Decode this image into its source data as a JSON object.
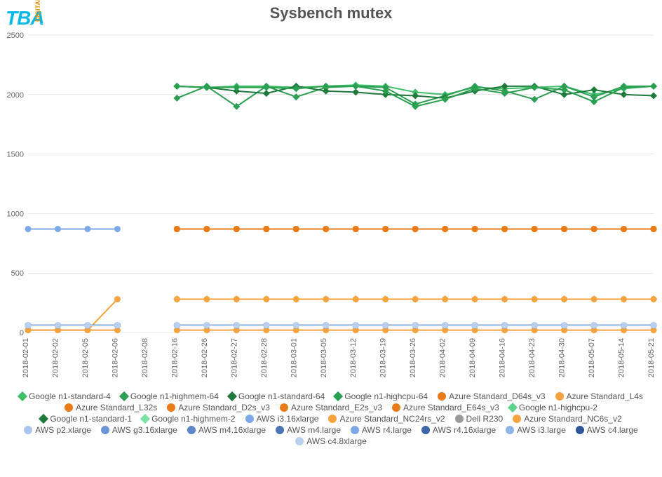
{
  "logo": {
    "main": "TBA",
    "sub": "DIGITAL"
  },
  "chart_data": {
    "type": "line",
    "title": "Sysbench mutex",
    "xlabel": "",
    "ylabel": "",
    "ylim": [
      0,
      2500
    ],
    "yticks": [
      0,
      500,
      1000,
      1500,
      2000,
      2500
    ],
    "categories": [
      "2018-02-01",
      "2018-02-02",
      "2018-02-05",
      "2018-02-06",
      "2018-02-08",
      "2018-02-16",
      "2018-02-26",
      "2018-02-27",
      "2018-02-28",
      "2018-03-01",
      "2018-03-05",
      "2018-03-12",
      "2018-03-19",
      "2018-03-26",
      "2018-04-02",
      "2018-04-09",
      "2018-04-16",
      "2018-04-23",
      "2018-04-30",
      "2018-05-07",
      "2018-05-14",
      "2018-05-21"
    ],
    "series": [
      {
        "name": "Google n1-standard-4",
        "color": "#3fbf6a",
        "shape": "diamond",
        "values": [
          null,
          null,
          null,
          null,
          null,
          2070,
          2060,
          2070,
          2070,
          2060,
          2070,
          2080,
          2070,
          2020,
          2000,
          2060,
          2050,
          2060,
          2070,
          2000,
          2050,
          2070
        ]
      },
      {
        "name": "Google n1-highmem-64",
        "color": "#2e9e55",
        "shape": "diamond",
        "values": [
          null,
          null,
          null,
          null,
          null,
          1970,
          2070,
          1900,
          2070,
          1980,
          2060,
          2070,
          2060,
          1920,
          1990,
          2070,
          2030,
          1960,
          2070,
          1980,
          2070,
          2070
        ]
      },
      {
        "name": "Google n1-standard-64",
        "color": "#1f7a3c",
        "shape": "diamond",
        "values": [
          null,
          null,
          null,
          null,
          null,
          2070,
          2060,
          2030,
          2010,
          2070,
          2030,
          2020,
          2000,
          1990,
          1970,
          2030,
          2070,
          2070,
          2000,
          2040,
          2000,
          1990
        ]
      },
      {
        "name": "Google n1-highcpu-64",
        "color": "#28a04f",
        "shape": "diamond",
        "values": [
          null,
          null,
          null,
          null,
          null,
          2070,
          2060,
          2060,
          2060,
          2050,
          2070,
          2070,
          2030,
          1900,
          1960,
          2050,
          2010,
          2060,
          2040,
          1940,
          2060,
          2070
        ]
      },
      {
        "name": "Azure Standard_D64s_v3",
        "color": "#e87c1a",
        "shape": "circle",
        "values": [
          null,
          null,
          null,
          null,
          null,
          870,
          870,
          870,
          870,
          870,
          870,
          870,
          870,
          870,
          870,
          870,
          870,
          870,
          870,
          870,
          870,
          870
        ]
      },
      {
        "name": "Azure Standard_L4s",
        "color": "#f5a33e",
        "shape": "circle",
        "values": [
          null,
          null,
          null,
          null,
          null,
          870,
          870,
          870,
          870,
          870,
          870,
          870,
          870,
          870,
          870,
          870,
          870,
          870,
          870,
          870,
          870,
          870
        ]
      },
      {
        "name": "Azure Standard_L32s",
        "color": "#e87c1a",
        "shape": "circle",
        "values": [
          null,
          null,
          null,
          null,
          null,
          870,
          870,
          870,
          870,
          870,
          870,
          870,
          870,
          870,
          870,
          870,
          870,
          870,
          870,
          870,
          870,
          870
        ]
      },
      {
        "name": "Azure Standard_D2s_v3",
        "color": "#e87c1a",
        "shape": "circle",
        "values": [
          null,
          null,
          null,
          null,
          null,
          870,
          870,
          870,
          870,
          870,
          870,
          870,
          870,
          870,
          870,
          870,
          870,
          870,
          870,
          870,
          870,
          870
        ]
      },
      {
        "name": "Azure Standard_E2s_v3",
        "color": "#e87c1a",
        "shape": "circle",
        "values": [
          null,
          null,
          null,
          null,
          null,
          870,
          870,
          870,
          870,
          870,
          870,
          870,
          870,
          870,
          870,
          870,
          870,
          870,
          870,
          870,
          870,
          870
        ]
      },
      {
        "name": "Azure Standard_E64s_v3",
        "color": "#e87c1a",
        "shape": "circle",
        "values": [
          null,
          null,
          null,
          null,
          null,
          870,
          870,
          870,
          870,
          870,
          870,
          870,
          870,
          870,
          870,
          870,
          870,
          870,
          870,
          870,
          870,
          870
        ]
      },
      {
        "name": "Google n1-highcpu-2",
        "color": "#5ed38a",
        "shape": "diamond",
        "values": [
          null,
          null,
          null,
          null,
          null,
          280,
          280,
          280,
          280,
          280,
          280,
          280,
          280,
          280,
          280,
          280,
          280,
          280,
          280,
          280,
          280,
          280
        ]
      },
      {
        "name": "Google n1-standard-1",
        "color": "#1f7a3c",
        "shape": "diamond",
        "values": [
          null,
          null,
          null,
          null,
          null,
          280,
          280,
          280,
          280,
          280,
          280,
          280,
          280,
          280,
          280,
          280,
          280,
          280,
          280,
          280,
          280,
          280
        ]
      },
      {
        "name": "Google n1-highmem-2",
        "color": "#7de0a5",
        "shape": "diamond",
        "values": [
          null,
          null,
          null,
          null,
          null,
          280,
          280,
          280,
          280,
          280,
          280,
          280,
          280,
          280,
          280,
          280,
          280,
          280,
          280,
          280,
          280,
          280
        ]
      },
      {
        "name": "AWS i3.16xlarge",
        "color": "#7da8e6",
        "shape": "circle",
        "values": [
          870,
          870,
          870,
          870,
          null,
          null,
          null,
          null,
          null,
          null,
          null,
          null,
          null,
          null,
          null,
          null,
          null,
          null,
          null,
          null,
          null,
          null
        ]
      },
      {
        "name": "Azure Standard_NC24rs_v2",
        "color": "#f5a33e",
        "shape": "circle",
        "values": [
          20,
          20,
          20,
          280,
          null,
          280,
          280,
          280,
          280,
          280,
          280,
          280,
          280,
          280,
          280,
          280,
          280,
          280,
          280,
          280,
          280,
          280
        ]
      },
      {
        "name": "Dell R230",
        "color": "#9a9a9a",
        "shape": "circle",
        "values": [
          null,
          null,
          null,
          null,
          null,
          null,
          null,
          null,
          null,
          null,
          null,
          null,
          null,
          null,
          null,
          null,
          null,
          null,
          null,
          null,
          null,
          null
        ]
      },
      {
        "name": "Azure Standard_NC6s_v2",
        "color": "#f5a33e",
        "shape": "circle",
        "values": [
          20,
          20,
          20,
          20,
          null,
          20,
          20,
          20,
          20,
          20,
          20,
          20,
          20,
          20,
          20,
          20,
          20,
          20,
          20,
          20,
          20,
          20
        ]
      },
      {
        "name": "AWS p2.xlarge",
        "color": "#a9c4ed",
        "shape": "circle",
        "values": [
          60,
          60,
          60,
          60,
          null,
          60,
          60,
          60,
          60,
          60,
          60,
          60,
          60,
          60,
          60,
          60,
          60,
          60,
          60,
          60,
          60,
          60
        ]
      },
      {
        "name": "AWS g3.16xlarge",
        "color": "#6e96d6",
        "shape": "circle",
        "values": [
          60,
          60,
          60,
          60,
          null,
          60,
          60,
          60,
          60,
          60,
          60,
          60,
          60,
          60,
          60,
          60,
          60,
          60,
          60,
          60,
          60,
          60
        ]
      },
      {
        "name": "AWS m4.16xlarge",
        "color": "#5c86c9",
        "shape": "circle",
        "values": [
          60,
          60,
          60,
          60,
          null,
          60,
          60,
          60,
          60,
          60,
          60,
          60,
          60,
          60,
          60,
          60,
          60,
          60,
          60,
          60,
          60,
          60
        ]
      },
      {
        "name": "AWS m4.large",
        "color": "#4a74b5",
        "shape": "circle",
        "values": [
          60,
          60,
          60,
          60,
          null,
          60,
          60,
          60,
          60,
          60,
          60,
          60,
          60,
          60,
          60,
          60,
          60,
          60,
          60,
          60,
          60,
          60
        ]
      },
      {
        "name": "AWS r4.large",
        "color": "#7da8e6",
        "shape": "circle",
        "values": [
          60,
          60,
          60,
          60,
          null,
          60,
          60,
          60,
          60,
          60,
          60,
          60,
          60,
          60,
          60,
          60,
          60,
          60,
          60,
          60,
          60,
          60
        ]
      },
      {
        "name": "AWS r4.16xlarge",
        "color": "#3d66aa",
        "shape": "circle",
        "values": [
          60,
          60,
          60,
          60,
          null,
          60,
          60,
          60,
          60,
          60,
          60,
          60,
          60,
          60,
          60,
          60,
          60,
          60,
          60,
          60,
          60,
          60
        ]
      },
      {
        "name": "AWS i3.large",
        "color": "#8fb4e8",
        "shape": "circle",
        "values": [
          60,
          60,
          60,
          60,
          null,
          60,
          60,
          60,
          60,
          60,
          60,
          60,
          60,
          60,
          60,
          60,
          60,
          60,
          60,
          60,
          60,
          60
        ]
      },
      {
        "name": "AWS c4.large",
        "color": "#2f5699",
        "shape": "circle",
        "values": [
          60,
          60,
          60,
          60,
          null,
          60,
          60,
          60,
          60,
          60,
          60,
          60,
          60,
          60,
          60,
          60,
          60,
          60,
          60,
          60,
          60,
          60
        ]
      },
      {
        "name": "AWS c4.8xlarge",
        "color": "#b9d0f0",
        "shape": "circle",
        "values": [
          60,
          60,
          60,
          60,
          null,
          60,
          60,
          60,
          60,
          60,
          60,
          60,
          60,
          60,
          60,
          60,
          60,
          60,
          60,
          60,
          60,
          60
        ]
      }
    ]
  }
}
